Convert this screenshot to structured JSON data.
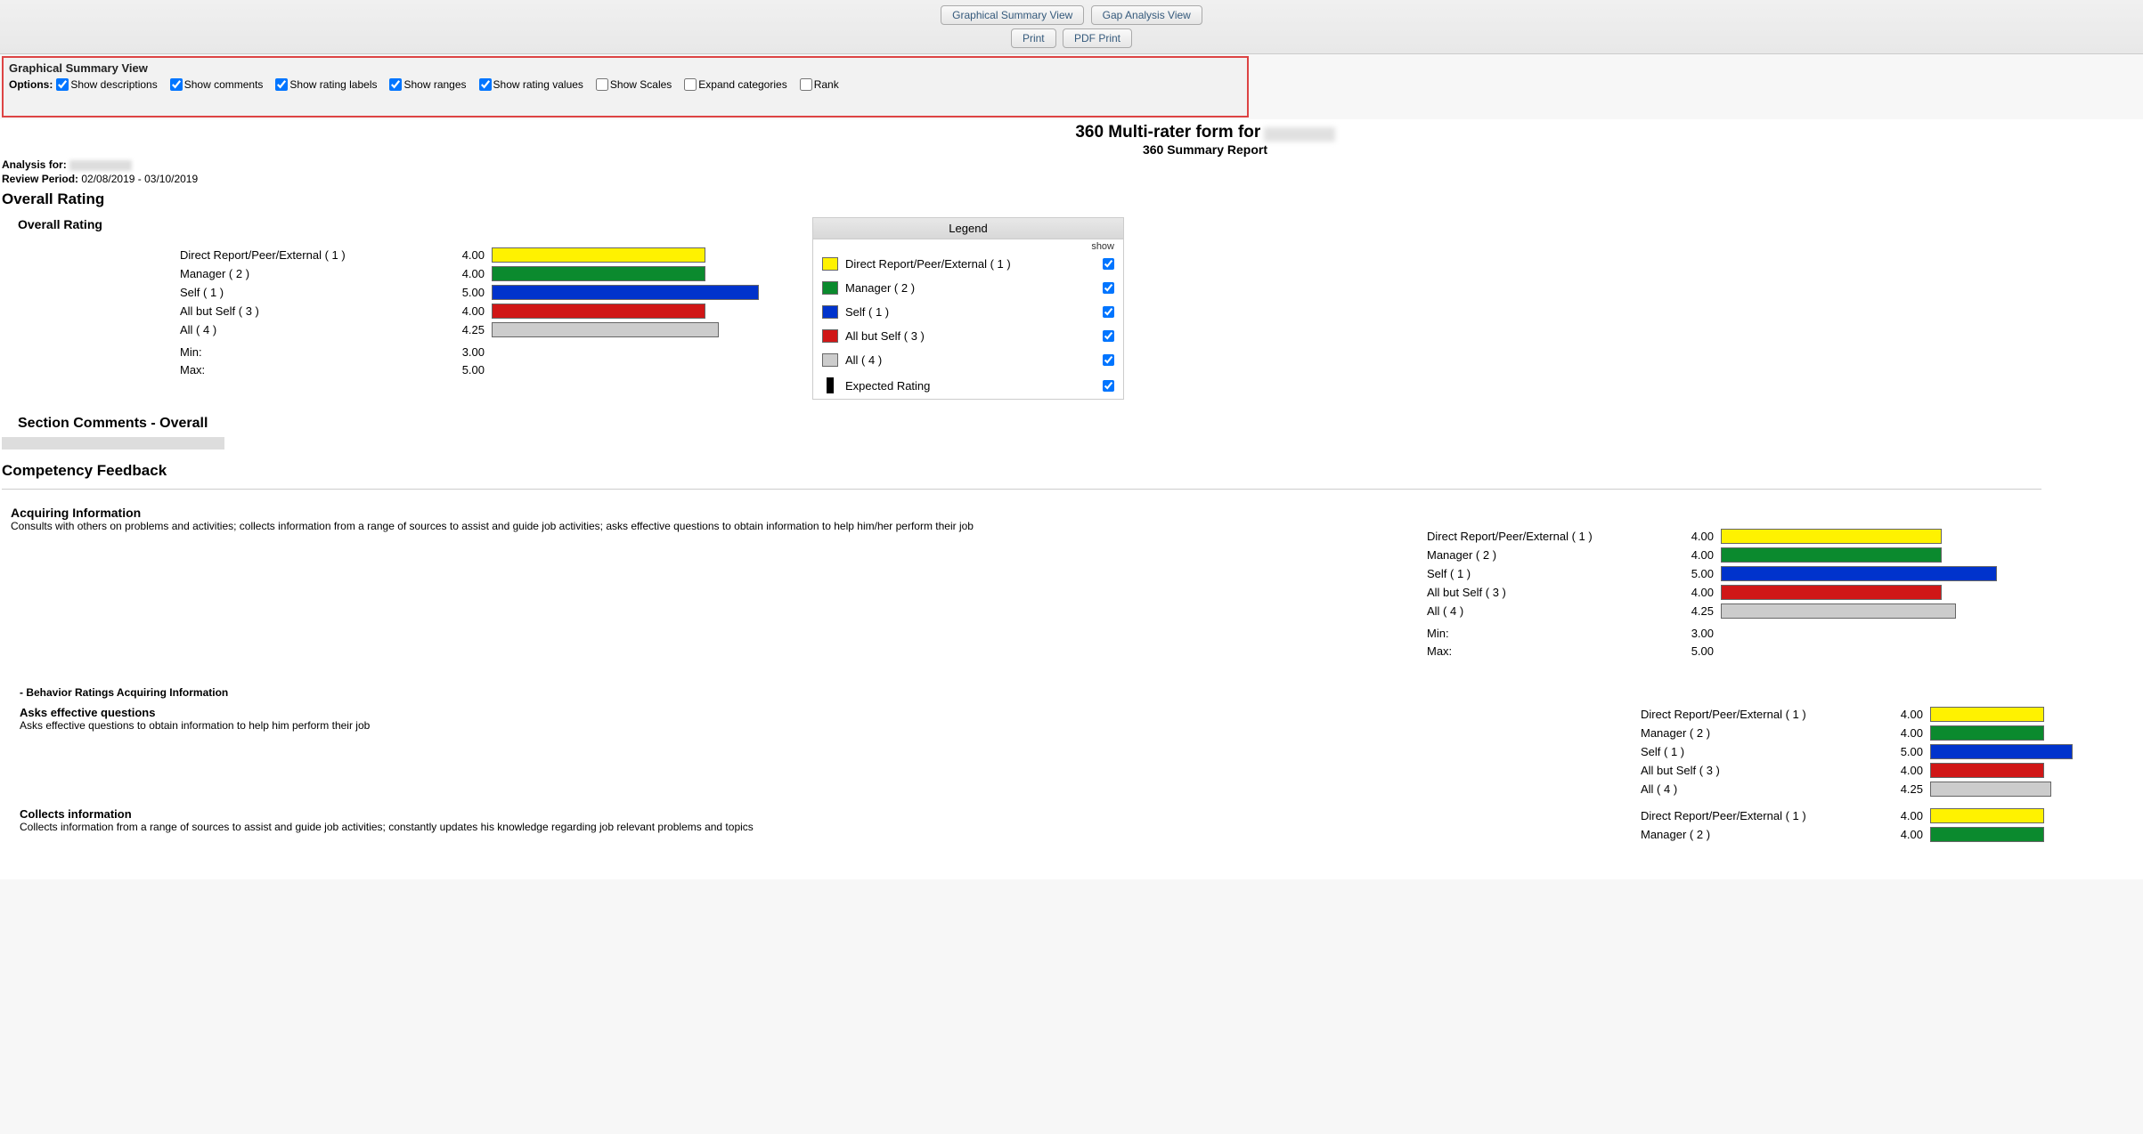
{
  "top": {
    "graphical_btn": "Graphical Summary View",
    "gap_btn": "Gap Analysis View",
    "print_btn": "Print",
    "pdf_btn": "PDF Print"
  },
  "options_panel": {
    "title": "Graphical Summary View",
    "label": "Options:",
    "items": [
      {
        "label": "Show descriptions",
        "checked": true
      },
      {
        "label": "Show comments",
        "checked": true
      },
      {
        "label": "Show rating labels",
        "checked": true
      },
      {
        "label": "Show ranges",
        "checked": true
      },
      {
        "label": "Show rating values",
        "checked": true
      },
      {
        "label": "Show Scales",
        "checked": false
      },
      {
        "label": "Expand categories",
        "checked": false
      },
      {
        "label": "Rank",
        "checked": false
      }
    ]
  },
  "header": {
    "title": "360 Multi-rater form for",
    "subtitle": "360 Summary Report",
    "analysis_label": "Analysis for:",
    "review_label": "Review Period:",
    "review_value": "02/08/2019 - 03/10/2019"
  },
  "overall_section_title": "Overall Rating",
  "overall_group_title": "Overall Rating",
  "min_label": "Min:",
  "max_label": "Max:",
  "legend": {
    "title": "Legend",
    "show": "show",
    "items": [
      {
        "label": "Direct Report/Peer/External ( 1 )",
        "color": "yellow"
      },
      {
        "label": "Manager ( 2 )",
        "color": "green"
      },
      {
        "label": "Self ( 1 )",
        "color": "blue"
      },
      {
        "label": "All but Self ( 3 )",
        "color": "red"
      },
      {
        "label": "All ( 4 )",
        "color": "grey"
      },
      {
        "label": "Expected Rating",
        "color": "black"
      }
    ]
  },
  "section_comments": "Section Comments - Overall",
  "competency_feedback": "Competency Feedback",
  "comp1": {
    "title": "Acquiring Information",
    "desc": "Consults with others on problems and activities; collects information from a range of sources to assist and guide job activities; asks effective questions to obtain information to help him/her perform their job"
  },
  "behav_header": "- Behavior Ratings Acquiring Information",
  "behav1": {
    "title": "Asks effective questions",
    "desc": "Asks effective questions to obtain information to help him perform their job"
  },
  "behav2": {
    "title": "Collects information",
    "desc": "Collects information from a range of sources to assist and guide job activities; constantly updates his knowledge regarding job relevant problems and topics"
  },
  "chart_data": [
    {
      "type": "bar",
      "title": "Overall Rating",
      "xlabel": "",
      "ylabel": "",
      "ylim": [
        0,
        5
      ],
      "categories": [
        "Direct Report/Peer/External ( 1 )",
        "Manager ( 2 )",
        "Self ( 1 )",
        "All but Self ( 3 )",
        "All ( 4 )"
      ],
      "values": [
        4.0,
        4.0,
        5.0,
        4.0,
        4.25
      ],
      "min": 3.0,
      "max": 5.0,
      "colors": [
        "yellow",
        "green",
        "blue",
        "red",
        "grey"
      ]
    },
    {
      "type": "bar",
      "title": "Acquiring Information",
      "xlabel": "",
      "ylabel": "",
      "ylim": [
        0,
        5
      ],
      "categories": [
        "Direct Report/Peer/External ( 1 )",
        "Manager ( 2 )",
        "Self ( 1 )",
        "All but Self ( 3 )",
        "All ( 4 )"
      ],
      "values": [
        4.0,
        4.0,
        5.0,
        4.0,
        4.25
      ],
      "min": 3.0,
      "max": 5.0,
      "colors": [
        "yellow",
        "green",
        "blue",
        "red",
        "grey"
      ]
    },
    {
      "type": "bar",
      "title": "Asks effective questions",
      "xlabel": "",
      "ylabel": "",
      "ylim": [
        0,
        5
      ],
      "categories": [
        "Direct Report/Peer/External ( 1 )",
        "Manager ( 2 )",
        "Self ( 1 )",
        "All but Self ( 3 )",
        "All ( 4 )"
      ],
      "values": [
        4.0,
        4.0,
        5.0,
        4.0,
        4.25
      ],
      "colors": [
        "yellow",
        "green",
        "blue",
        "red",
        "grey"
      ]
    },
    {
      "type": "bar",
      "title": "Collects information",
      "xlabel": "",
      "ylabel": "",
      "ylim": [
        0,
        5
      ],
      "categories": [
        "Direct Report/Peer/External ( 1 )",
        "Manager ( 2 )"
      ],
      "values": [
        4.0,
        4.0
      ],
      "colors": [
        "yellow",
        "green"
      ]
    }
  ]
}
